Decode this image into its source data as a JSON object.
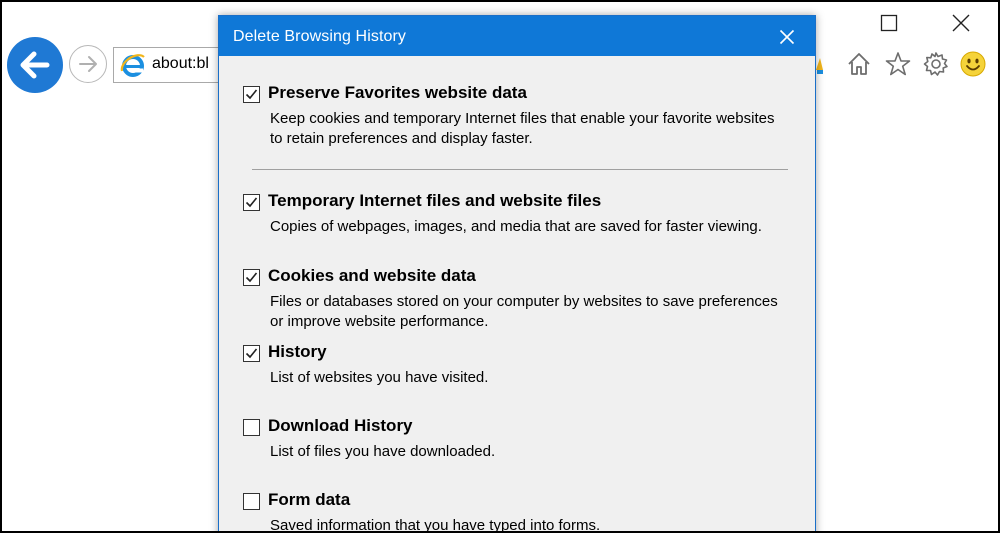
{
  "browser": {
    "address": "about:bl",
    "controls": {
      "back": "back-arrow-icon",
      "forward": "forward-arrow-icon"
    },
    "toolbar_icons": [
      "home-icon",
      "star-icon",
      "gear-icon",
      "smiley-icon"
    ],
    "accent_color": "#1f79d4"
  },
  "dialog": {
    "title": "Delete Browsing History",
    "titlebar_color": "#0f78d7",
    "options": [
      {
        "label": "Preserve Favorites website data",
        "checked": true,
        "description": "Keep cookies and temporary Internet files that enable your favorite websites to retain preferences and display faster."
      },
      {
        "label": "Temporary Internet files and website files",
        "checked": true,
        "description": "Copies of webpages, images, and media that are saved for faster viewing."
      },
      {
        "label": "Cookies and website data",
        "checked": true,
        "description": "Files or databases stored on your computer by websites to save preferences or improve website performance."
      },
      {
        "label": "History",
        "checked": true,
        "description": "List of websites you have visited."
      },
      {
        "label": "Download History",
        "checked": false,
        "description": "List of files you have downloaded."
      },
      {
        "label": "Form data",
        "checked": false,
        "description": "Saved information that you have typed into forms."
      }
    ]
  }
}
